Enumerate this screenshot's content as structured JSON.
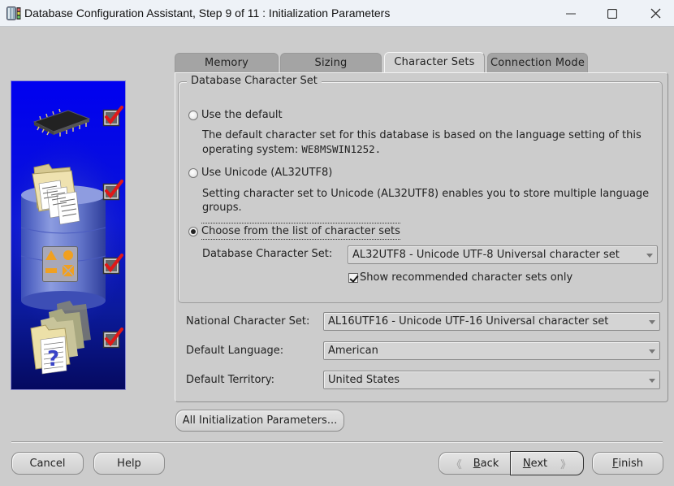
{
  "window": {
    "title": "Database Configuration Assistant, Step 9 of 11 : Initialization Parameters",
    "controls": {
      "minimize": "minimize",
      "maximize": "maximize",
      "close": "close"
    }
  },
  "side_steps": [
    {
      "icon": "memory-chip-icon",
      "completed": true
    },
    {
      "icon": "database-files-icon",
      "completed": true
    },
    {
      "icon": "shapes-objects-icon",
      "completed": true
    },
    {
      "icon": "help-documents-icon",
      "completed": true
    }
  ],
  "tabs": [
    {
      "label": "Memory",
      "active": false
    },
    {
      "label": "Sizing",
      "active": false
    },
    {
      "label": "Character Sets",
      "active": true
    },
    {
      "label": "Connection Mode",
      "active": false
    }
  ],
  "charset_group": {
    "title": "Database Character Set",
    "options": [
      {
        "label": "Use the default",
        "checked": false
      },
      {
        "label": "Use Unicode (AL32UTF8)",
        "checked": false
      },
      {
        "label": "Choose from the list of character sets",
        "checked": true
      }
    ],
    "default_desc_prefix": "The default character set for this database is based on the language setting of this operating system: ",
    "default_desc_value": "WE8MSWIN1252.",
    "unicode_desc": "Setting character set to Unicode (AL32UTF8) enables you to store multiple language groups.",
    "db_charset_label": "Database Character Set:",
    "db_charset_value": "AL32UTF8 - Unicode UTF-8 Universal character set",
    "show_recommended_label": "Show recommended character sets only",
    "show_recommended_checked": true
  },
  "fields": {
    "national_label": "National Character Set:",
    "national_value": "AL16UTF16 - Unicode UTF-16 Universal character set",
    "language_label": "Default Language:",
    "language_value": "American",
    "territory_label": "Default Territory:",
    "territory_value": "United States"
  },
  "all_params_button": "All Initialization Parameters...",
  "footer": {
    "cancel": "Cancel",
    "help": "Help",
    "back_mnemonic": "B",
    "back_rest": "ack",
    "next_mnemonic": "N",
    "next_rest": "ext",
    "finish_mnemonic": "F",
    "finish_rest": "inish"
  }
}
